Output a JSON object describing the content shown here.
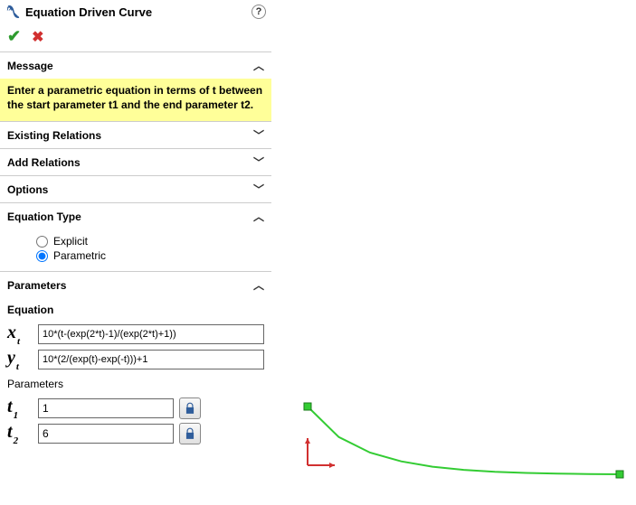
{
  "header": {
    "title": "Equation Driven Curve"
  },
  "sections": {
    "message": {
      "title": "Message",
      "body": "Enter a parametric equation in terms of t between the start parameter t1 and the end parameter t2."
    },
    "existingRelations": {
      "title": "Existing Relations"
    },
    "addRelations": {
      "title": "Add Relations"
    },
    "options": {
      "title": "Options"
    },
    "equationType": {
      "title": "Equation Type",
      "explicit_label": "Explicit",
      "parametric_label": "Parametric",
      "selected": "parametric"
    },
    "parameters": {
      "title": "Parameters",
      "equation_label": "Equation",
      "parameters_label": "Parameters",
      "xt": "10*(t-(exp(2*t)-1)/(exp(2*t)+1))",
      "yt": "10*(2/(exp(t)-exp(-t)))+1",
      "t1": "1",
      "t2": "6"
    }
  },
  "chart_data": {
    "type": "line",
    "title": "",
    "xlabel": "",
    "ylabel": "",
    "series": [
      {
        "name": "curve",
        "color": "#33cc33",
        "x": [
          1.0,
          1.5,
          2.0,
          2.5,
          3.0,
          3.5,
          4.0,
          4.5,
          5.0,
          5.5,
          6.0
        ],
        "y": [
          9.51,
          5.7,
          3.76,
          2.66,
          2.0,
          1.6,
          1.37,
          1.22,
          1.13,
          1.08,
          1.05
        ]
      }
    ],
    "endpoints": [
      {
        "x": 1.0,
        "y": 9.51
      },
      {
        "x": 6.0,
        "y": 1.05
      }
    ]
  }
}
